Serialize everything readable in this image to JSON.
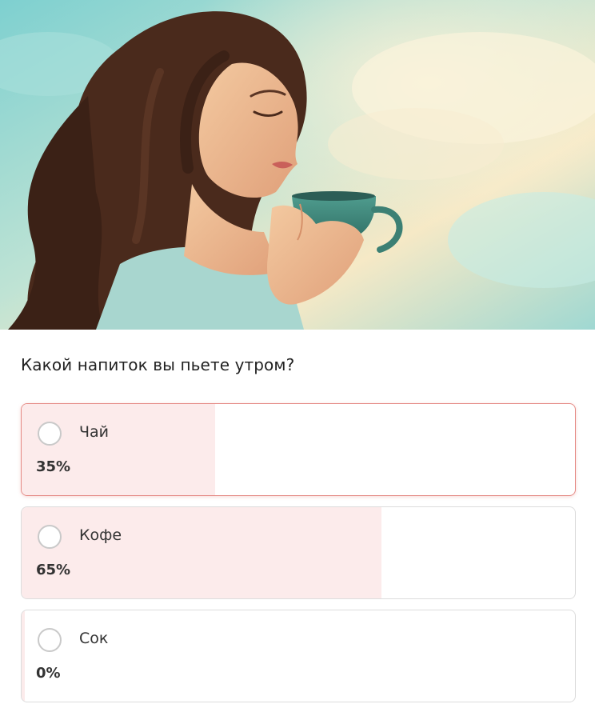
{
  "poll": {
    "question": "Какой напиток вы пьете утром?",
    "options": [
      {
        "label": "Чай",
        "percent_text": "35%",
        "percent": 35,
        "selected": true
      },
      {
        "label": "Кофе",
        "percent_text": "65%",
        "percent": 65,
        "selected": false
      },
      {
        "label": "Сок",
        "percent_text": "0%",
        "percent": 0,
        "selected": false
      }
    ]
  },
  "colors": {
    "selected_border": "#e58b86",
    "fill": "#fcebeb",
    "border": "#dcdcdc"
  },
  "hero": {
    "subject": "illustration-woman-drinking-from-teal-cup"
  }
}
